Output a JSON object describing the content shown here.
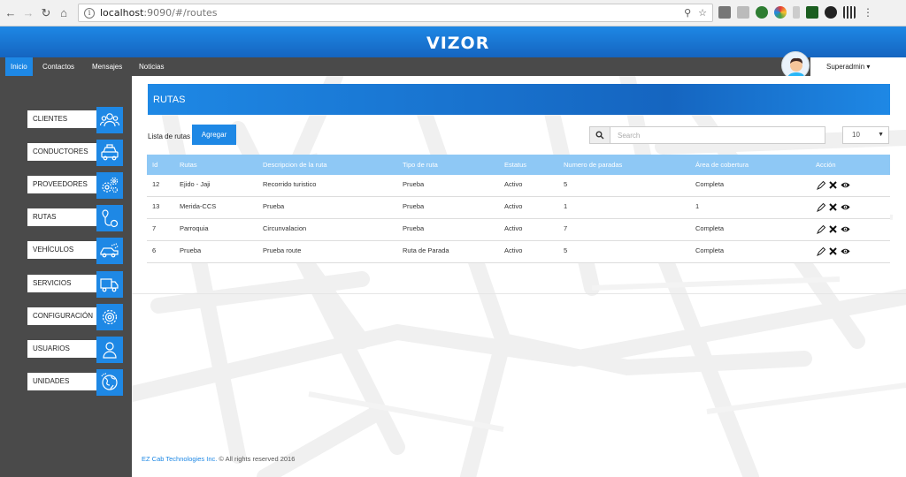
{
  "browser": {
    "url_host": "localhost",
    "url_path": ":9090/#/routes"
  },
  "app": {
    "logo": "VIZOR",
    "menu": [
      "Inicio",
      "Contactos",
      "Mensajes",
      "Noticias"
    ],
    "user": "Superadmin"
  },
  "sidebar": {
    "items": [
      {
        "label": "CLIENTES",
        "icon": "users-icon"
      },
      {
        "label": "CONDUCTORES",
        "icon": "taxi-icon"
      },
      {
        "label": "PROVEEDORES",
        "icon": "gears-icon"
      },
      {
        "label": "RUTAS",
        "icon": "route-pin-icon"
      },
      {
        "label": "VEHÍCULOS",
        "icon": "vehicle-icon"
      },
      {
        "label": "SERVICIOS",
        "icon": "truck-icon"
      },
      {
        "label": "CONFIGURACIÓN",
        "icon": "settings-icon"
      },
      {
        "label": "USUARIOS",
        "icon": "user-icon"
      },
      {
        "label": "UNIDADES",
        "icon": "globe-icon"
      }
    ]
  },
  "panel": {
    "title": "RUTAS",
    "list_label": "Lista de rutas",
    "add_button": "Agregar",
    "search_placeholder": "Search",
    "page_size": "10"
  },
  "table": {
    "headers": [
      "Id",
      "Rutas",
      "Descripcion de la ruta",
      "Tipo de ruta",
      "Estatus",
      "Numero de paradas",
      "Área de cobertura",
      "Acción"
    ],
    "rows": [
      [
        "12",
        "Ejido - Jaji",
        "Recorrido turistico",
        "Prueba",
        "Activo",
        "5",
        "Completa"
      ],
      [
        "13",
        "Merida-CCS",
        "Prueba",
        "Prueba",
        "Activo",
        "1",
        "1"
      ],
      [
        "7",
        "Parroquia",
        "Circunvalacion",
        "Prueba",
        "Activo",
        "7",
        "Completa"
      ],
      [
        "6",
        "Prueba",
        "Prueba route",
        "Ruta de Parada",
        "Activo",
        "5",
        "Completa"
      ]
    ]
  },
  "footer": {
    "company": "EZ Cab Technologies Inc.",
    "rights": " © All rights reserved 2016"
  },
  "colors": {
    "brand_blue": "#1e88e5",
    "header_light_blue": "#8ec8f5",
    "sidebar_dark": "#4a4a4a"
  }
}
